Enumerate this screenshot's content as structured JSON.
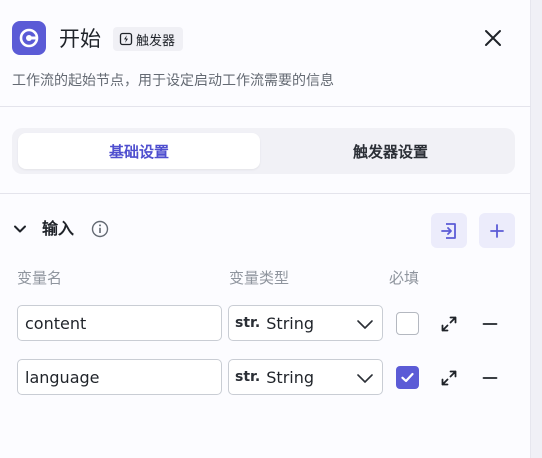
{
  "header": {
    "title": "开始",
    "badge_label": "触发器",
    "description": "工作流的起始节点，用于设定启动工作流需要的信息"
  },
  "tabs": [
    {
      "label": "基础设置",
      "active": true
    },
    {
      "label": "触发器设置",
      "active": false
    }
  ],
  "input_section": {
    "title": "输入",
    "columns": {
      "name": "变量名",
      "type": "变量类型",
      "required": "必填"
    },
    "rows": [
      {
        "name": "content",
        "type_prefix": "str.",
        "type": "String",
        "required": false
      },
      {
        "name": "language",
        "type_prefix": "str.",
        "type": "String",
        "required": true
      }
    ]
  },
  "colors": {
    "accent": "#5b5bd6",
    "accent_light": "#ececfb"
  }
}
